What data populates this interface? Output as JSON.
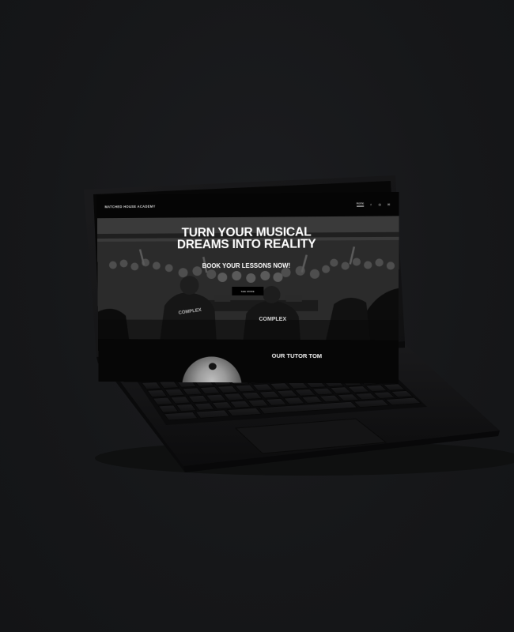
{
  "site": {
    "logo": "MATCHED HOUSE ACADEMY",
    "nav_home": "Home",
    "nav_icons": [
      "facebook-icon",
      "instagram-icon",
      "email-icon"
    ],
    "nav_icon_glyphs": [
      "f",
      "◎",
      "✉"
    ]
  },
  "hero": {
    "title_line1": "TURN YOUR MUSICAL",
    "title_line2": "DREAMS INTO REALITY",
    "subtitle": "BOOK YOUR LESSONS NOW!",
    "button_label": "SEE MORE",
    "shirt_text_left": "COMPLEX",
    "shirt_text_right": "COMPLEX"
  },
  "tutor": {
    "title": "OUR TUTOR TOM"
  },
  "colors": {
    "background": "#17181a",
    "laptop_body": "#0d0d0e",
    "screen_header": "#050505",
    "text": "#ffffff"
  }
}
